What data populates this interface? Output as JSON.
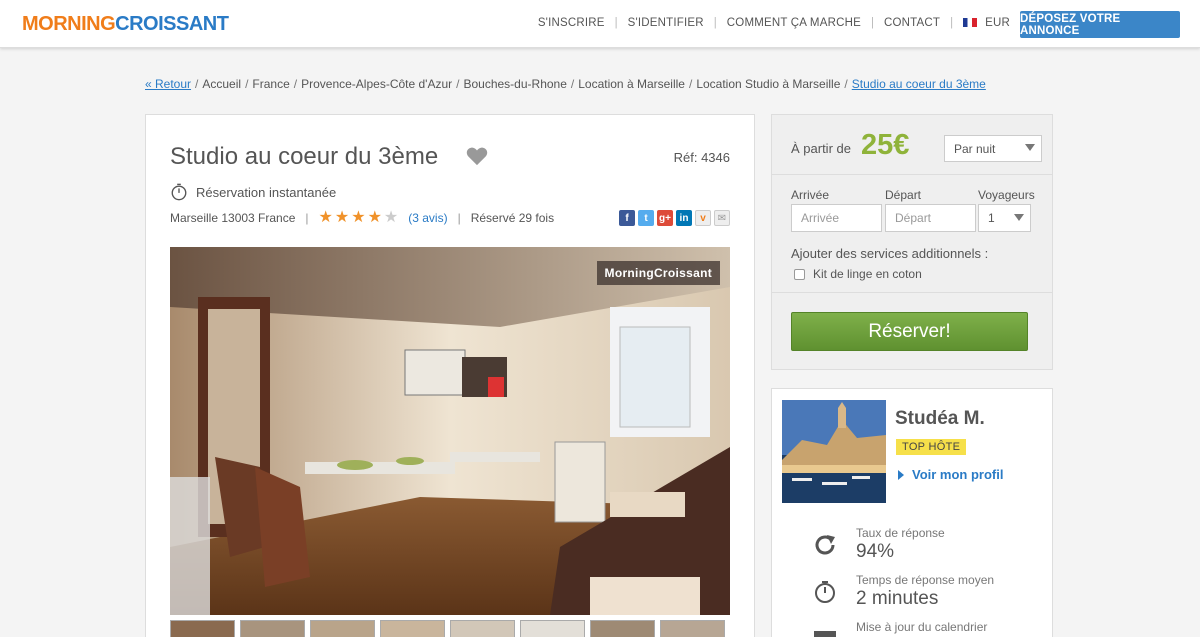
{
  "header": {
    "logo_part1": "MORNING",
    "logo_part2": "CROISSANT",
    "nav": [
      "S'INSCRIRE",
      "S'IDENTIFIER",
      "COMMENT ÇA MARCHE",
      "CONTACT"
    ],
    "currency": "EUR",
    "cta_label": "DÉPOSEZ VOTRE ANNONCE"
  },
  "breadcrumb": {
    "back": "« Retour",
    "items": [
      "Accueil",
      "France",
      "Provence-Alpes-Côte d'Azur",
      "Bouches-du-Rhone",
      "Location à Marseille",
      "Location Studio à Marseille"
    ],
    "current": "Studio au coeur du 3ème"
  },
  "listing": {
    "title": "Studio au coeur du 3ème",
    "ref": "Réf: 4346",
    "instant": "Réservation instantanée",
    "location": "Marseille 13003 France",
    "rating": 4,
    "reviews": "(3 avis)",
    "booked": "Réservé 29 fois",
    "watermark": "MorningCroissant",
    "share_icons": [
      "facebook-icon",
      "twitter-icon",
      "google-plus-icon",
      "linkedin-icon",
      "viadeo-icon",
      "email-icon"
    ]
  },
  "booking": {
    "from_label": "À partir de",
    "price": "25€",
    "period": "Par nuit",
    "arrival_label": "Arrivée",
    "arrival_placeholder": "Arrivée",
    "departure_label": "Départ",
    "departure_placeholder": "Départ",
    "guests_label": "Voyageurs",
    "guests_value": "1",
    "services_label": "Ajouter des services additionnels :",
    "service_option": "Kit de linge en coton",
    "reserve_label": "Réserver!"
  },
  "host": {
    "name": "Studéa M.",
    "badge": "TOP HÔTE",
    "profile_link": "Voir mon profil",
    "stats": [
      {
        "label": "Taux de réponse",
        "value": "94%",
        "icon": "refresh-icon"
      },
      {
        "label": "Temps de réponse moyen",
        "value": "2 minutes",
        "icon": "stopwatch-icon"
      },
      {
        "label": "Mise à jour du calendrier",
        "value": "",
        "icon": "calendar-icon"
      }
    ]
  },
  "colors": {
    "brand_orange": "#f07d1a",
    "brand_blue": "#2a7bc6",
    "price_green": "#8fb33a",
    "reserve_green": "#6fa03c",
    "star": "#f0922a",
    "badge_yellow": "#f6e04a"
  }
}
